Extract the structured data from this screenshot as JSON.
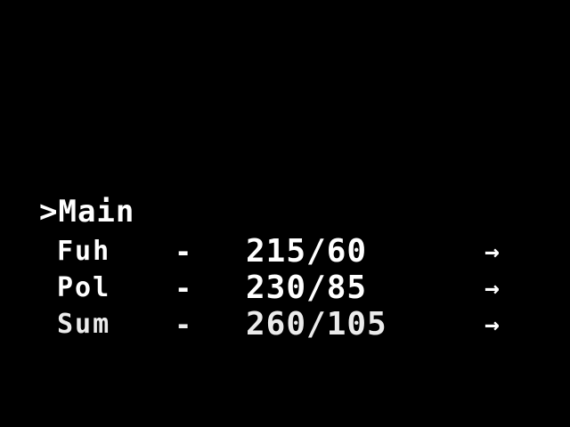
{
  "menu": {
    "cursor": ">",
    "title": "Main"
  },
  "rows": [
    {
      "name": "Fuh",
      "dash": "-",
      "value": "215/60",
      "arrow": "→"
    },
    {
      "name": "Pol",
      "dash": "-",
      "value": "230/85",
      "arrow": "→"
    },
    {
      "name": "Sum",
      "dash": "-",
      "value": "260/105",
      "arrow": "→"
    }
  ],
  "colors": {
    "background": "#000000",
    "text": "#ffffff"
  }
}
